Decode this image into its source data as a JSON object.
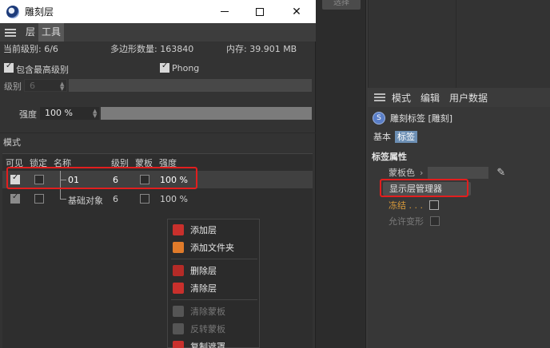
{
  "window": {
    "title": "雕刻层",
    "minimize": "—",
    "maximize": "□",
    "close": "✕"
  },
  "menubar": {
    "layer": "层",
    "tools": "工具"
  },
  "stats": {
    "current_level": "当前级别: 6/6",
    "polygons": "多边形数量: 163840",
    "memory": "内存: 39.901 MB"
  },
  "options": {
    "include_highest": {
      "label": "包含最高级别",
      "checked": true
    },
    "phong": {
      "label": "Phong",
      "checked": true
    }
  },
  "level": {
    "label": "级别",
    "value": "6"
  },
  "strength": {
    "label": "强度",
    "value": "100 %",
    "fraction": 1.0
  },
  "mode_label": "模式",
  "table": {
    "headers": {
      "visible": "可见",
      "lock": "锁定",
      "name": "名称",
      "level": "级别",
      "mask": "蒙板",
      "strength": "强度"
    },
    "rows": [
      {
        "visible": true,
        "locked": false,
        "name": "01",
        "level": "6",
        "mask": false,
        "strength": "100 %"
      },
      {
        "visible": true,
        "locked": false,
        "name": "基础对象",
        "level": "6",
        "mask": false,
        "strength": "100 %"
      }
    ]
  },
  "context_menu": {
    "items": [
      {
        "label": "添加层",
        "icon": "add-layer-icon",
        "enabled": true
      },
      {
        "label": "添加文件夹",
        "icon": "add-folder-icon",
        "enabled": true
      },
      {
        "label": "删除层",
        "icon": "trash-icon",
        "enabled": true
      },
      {
        "label": "清除层",
        "icon": "clear-layer-icon",
        "enabled": true
      },
      {
        "label": "清除蒙板",
        "icon": "clear-mask-icon",
        "enabled": false
      },
      {
        "label": "反转蒙板",
        "icon": "invert-mask-icon",
        "enabled": false
      },
      {
        "label": "复制遮罩",
        "icon": "copy-mask-icon",
        "enabled": true
      }
    ]
  },
  "viewport": {
    "select_button": "选择"
  },
  "attributes": {
    "menu": {
      "mode": "模式",
      "edit": "编辑",
      "user_data": "用户数据"
    },
    "title": "雕刻标签 [雕刻]",
    "tabs": {
      "basic": "基本",
      "tag": "标签"
    },
    "section": "标签属性",
    "mask_color_label": "蒙板色",
    "show_layer_manager": "显示层管理器",
    "freeze_label": "冻结 . . .",
    "allow_deform_label": "允许变形"
  },
  "colors": {
    "highlight": "#e21e1e",
    "accent_tab": "#6c8fb4",
    "freeze_text": "#d89a3a"
  }
}
